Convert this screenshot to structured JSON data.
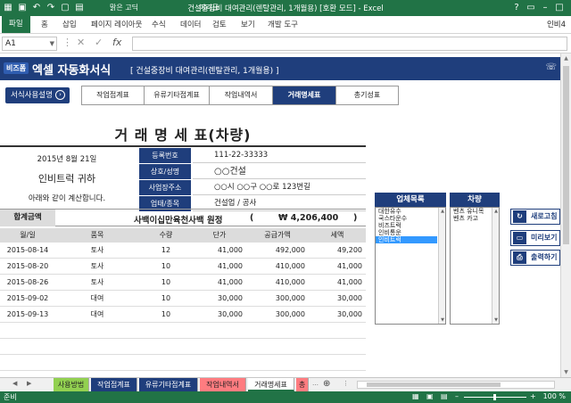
{
  "window": {
    "title": "건설중장비 대여관리(렌탈관리, 1개월용) [호환 모드] - Excel",
    "quick_access_font": "맑은 고딕",
    "quick_access_border": "머리글"
  },
  "ribbon": {
    "tabs": [
      "파일",
      "홈",
      "삽입",
      "페이지 레이아웃",
      "수식",
      "데이터",
      "검토",
      "보기",
      "개발 도구"
    ],
    "user": "인비4"
  },
  "formula_bar": {
    "name_box": "A1",
    "fx": "fx",
    "formula": ""
  },
  "banner": {
    "brand": "비즈폼",
    "title": "엑셀 자동화서식",
    "subtitle": "[ 건설중장비 대여관리(렌탈관리, 1개월용) ]",
    "phone_icon": "phone-icon"
  },
  "help_button": "서식사용설명",
  "nav_tabs": [
    {
      "label": "작업접계표",
      "active": false
    },
    {
      "label": "유류기타접계표",
      "active": false
    },
    {
      "label": "작업내역서",
      "active": false
    },
    {
      "label": "거래명세표",
      "active": true
    },
    {
      "label": "총기성표",
      "active": false
    }
  ],
  "invoice": {
    "title": "거 래 명 세 표(차량)",
    "date": "2015년   8월  21일",
    "recipient": "인비트럭  귀하",
    "note": "아래와 같이 계산합니다.",
    "fields": [
      {
        "label": "등록번호",
        "value": "111-22-33333"
      },
      {
        "label": "상호/성명",
        "value": "○○건설"
      },
      {
        "label": "사업장주소",
        "value": "○○시 ○○구 ○○로 123번길"
      },
      {
        "label": "업태/종목",
        "value": "건설업 / 공사"
      }
    ],
    "total_label": "합계금액",
    "total_korean": "사백이십만육천사백 원정",
    "total_open": "(",
    "total_number": "₩ 4,206,400",
    "total_close": ")",
    "columns": [
      "월/일",
      "품목",
      "수량",
      "단가",
      "공급가액",
      "세액"
    ],
    "rows": [
      {
        "date": "2015-08-14",
        "item": "토사",
        "qty": "12",
        "price": "41,000",
        "supply": "492,000",
        "tax": "49,200"
      },
      {
        "date": "2015-08-20",
        "item": "토사",
        "qty": "10",
        "price": "41,000",
        "supply": "410,000",
        "tax": "41,000"
      },
      {
        "date": "2015-08-26",
        "item": "토사",
        "qty": "10",
        "price": "41,000",
        "supply": "410,000",
        "tax": "41,000"
      },
      {
        "date": "2015-09-02",
        "item": "대여",
        "qty": "10",
        "price": "30,000",
        "supply": "300,000",
        "tax": "30,000"
      },
      {
        "date": "2015-09-13",
        "item": "대여",
        "qty": "10",
        "price": "30,000",
        "supply": "300,000",
        "tax": "30,000"
      }
    ]
  },
  "company_list": {
    "header": "업체목록",
    "items": [
      "대한유수",
      "국스타운수",
      "비즈트럭",
      "인비통운",
      "인비트럭"
    ],
    "selected_index": 4
  },
  "vehicle_list": {
    "header": "차량",
    "items": [
      "벤츠 유니목",
      "벤츠 카고"
    ]
  },
  "actions": [
    {
      "label": "새로고침",
      "icon": "refresh-icon"
    },
    {
      "label": "미리보기",
      "icon": "monitor-icon"
    },
    {
      "label": "출력하기",
      "icon": "print-icon"
    }
  ],
  "sheet_tabs": [
    {
      "label": "사용방법",
      "color": "#92d050"
    },
    {
      "label": "작업접계표",
      "color": "#1f3e7c"
    },
    {
      "label": "유류기타접계표",
      "color": "#1f3e7c"
    },
    {
      "label": "작업내역서",
      "color": "#ff7c80"
    },
    {
      "label": "거래명세표",
      "color": "#ffffff"
    },
    {
      "label": "총",
      "color": "#ff7c80"
    }
  ],
  "status": {
    "ready": "준비",
    "zoom": "100 %"
  }
}
